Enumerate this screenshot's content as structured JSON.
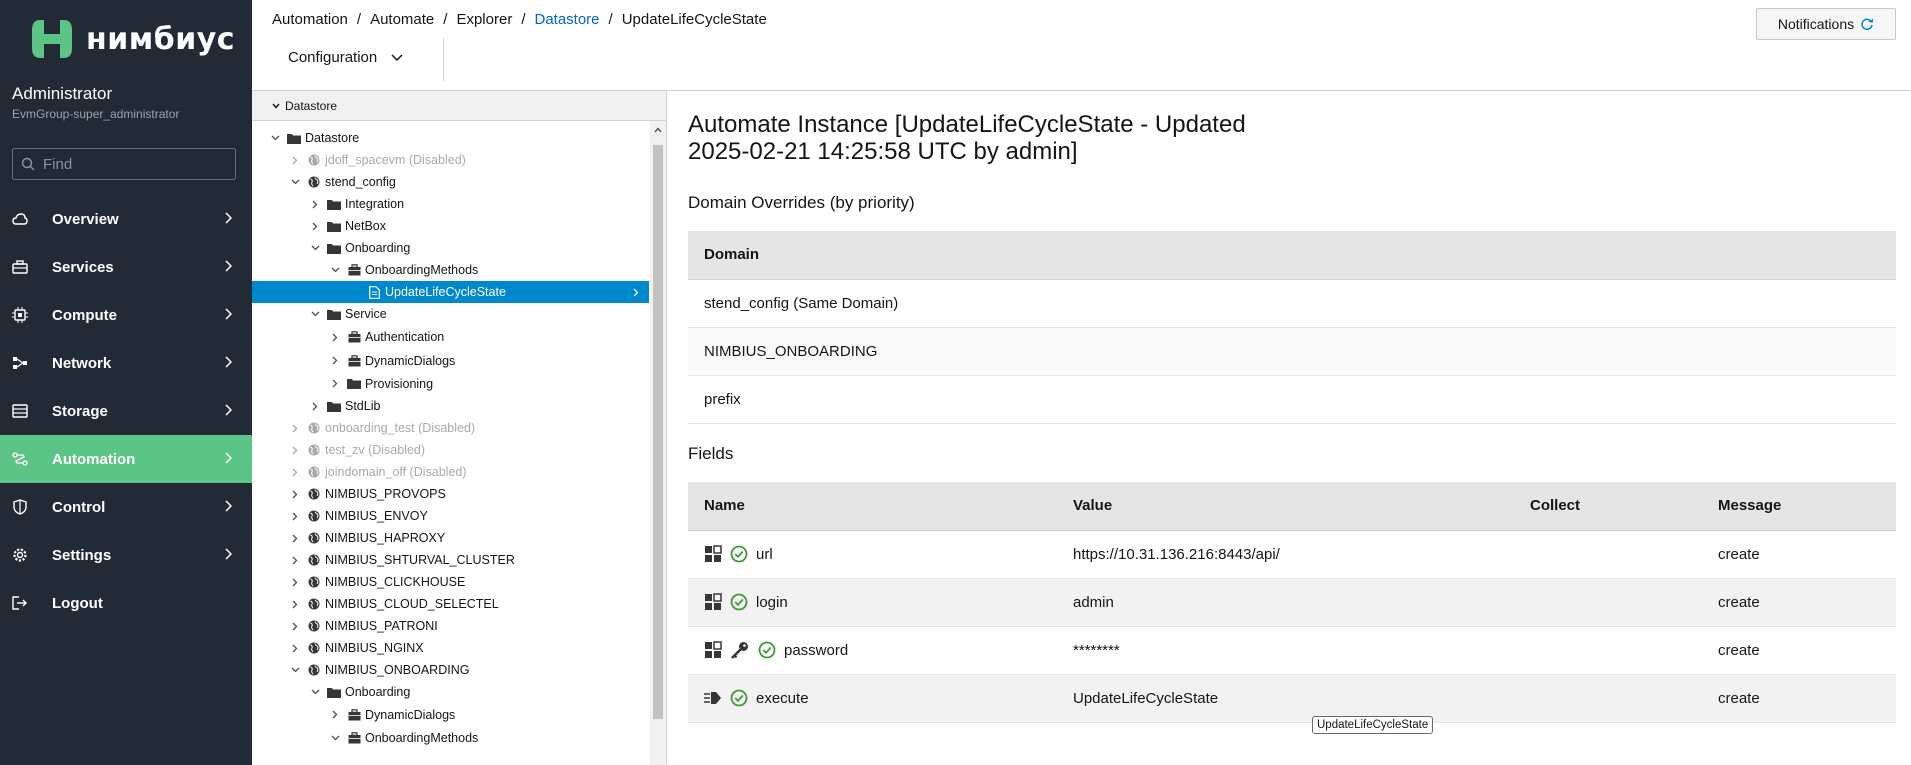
{
  "sidebar": {
    "logo_text": "нимбиус",
    "user_name": "Administrator",
    "user_group": "EvmGroup-super_administrator",
    "find_placeholder": "Find",
    "items": [
      {
        "label": "Overview",
        "icon": "cloud-icon"
      },
      {
        "label": "Services",
        "icon": "briefcase-icon"
      },
      {
        "label": "Compute",
        "icon": "cpu-icon"
      },
      {
        "label": "Network",
        "icon": "network-icon"
      },
      {
        "label": "Storage",
        "icon": "storage-icon"
      },
      {
        "label": "Automation",
        "icon": "automation-icon",
        "active": true
      },
      {
        "label": "Control",
        "icon": "shield-icon"
      },
      {
        "label": "Settings",
        "icon": "gear-icon"
      },
      {
        "label": "Logout",
        "icon": "logout-icon"
      }
    ]
  },
  "header": {
    "breadcrumb": [
      "Automation",
      "Automate",
      "Explorer",
      "Datastore",
      "UpdateLifeCycleState"
    ],
    "notifications_label": "Notifications",
    "config_label": "Configuration"
  },
  "tree": {
    "panel_title": "Datastore",
    "nodes": [
      {
        "label": "Datastore",
        "level": 0,
        "toggle": "open",
        "icon": "folder",
        "state": "normal"
      },
      {
        "label": "jdoff_spacevm (Disabled)",
        "level": 1,
        "toggle": "closed",
        "icon": "globe",
        "state": "disabled"
      },
      {
        "label": "stend_config",
        "level": 1,
        "toggle": "open",
        "icon": "globe",
        "state": "normal"
      },
      {
        "label": "Integration",
        "level": 2,
        "toggle": "closed",
        "icon": "folder",
        "state": "normal"
      },
      {
        "label": "NetBox",
        "level": 2,
        "toggle": "closed",
        "icon": "folder",
        "state": "normal"
      },
      {
        "label": "Onboarding",
        "level": 2,
        "toggle": "open",
        "icon": "folder",
        "state": "normal"
      },
      {
        "label": "OnboardingMethods",
        "level": 3,
        "toggle": "open",
        "icon": "class",
        "state": "normal"
      },
      {
        "label": "UpdateLifeCycleState",
        "level": 4,
        "toggle": "none",
        "icon": "doc",
        "state": "selected"
      },
      {
        "label": "Service",
        "level": 2,
        "toggle": "open",
        "icon": "folder",
        "state": "normal"
      },
      {
        "label": "Authentication",
        "level": 3,
        "toggle": "closed",
        "icon": "class",
        "state": "normal"
      },
      {
        "label": "DynamicDialogs",
        "level": 3,
        "toggle": "closed",
        "icon": "class",
        "state": "normal"
      },
      {
        "label": "Provisioning",
        "level": 3,
        "toggle": "closed",
        "icon": "folder",
        "state": "normal"
      },
      {
        "label": "StdLib",
        "level": 2,
        "toggle": "closed",
        "icon": "folder",
        "state": "normal"
      },
      {
        "label": "onboarding_test (Disabled)",
        "level": 1,
        "toggle": "closed",
        "icon": "globe",
        "state": "disabled"
      },
      {
        "label": "test_zv (Disabled)",
        "level": 1,
        "toggle": "closed",
        "icon": "globe",
        "state": "disabled"
      },
      {
        "label": "joindomain_off (Disabled)",
        "level": 1,
        "toggle": "closed",
        "icon": "globe",
        "state": "disabled"
      },
      {
        "label": "NIMBIUS_PROVOPS",
        "level": 1,
        "toggle": "closed",
        "icon": "globe",
        "state": "normal"
      },
      {
        "label": "NIMBIUS_ENVOY",
        "level": 1,
        "toggle": "closed",
        "icon": "globe",
        "state": "normal"
      },
      {
        "label": "NIMBIUS_HAPROXY",
        "level": 1,
        "toggle": "closed",
        "icon": "globe",
        "state": "normal"
      },
      {
        "label": "NIMBIUS_SHTURVAL_CLUSTER",
        "level": 1,
        "toggle": "closed",
        "icon": "globe",
        "state": "normal"
      },
      {
        "label": "NIMBIUS_CLICKHOUSE",
        "level": 1,
        "toggle": "closed",
        "icon": "globe",
        "state": "normal"
      },
      {
        "label": "NIMBIUS_CLOUD_SELECTEL",
        "level": 1,
        "toggle": "closed",
        "icon": "globe",
        "state": "normal"
      },
      {
        "label": "NIMBIUS_PATRONI",
        "level": 1,
        "toggle": "closed",
        "icon": "globe",
        "state": "normal"
      },
      {
        "label": "NIMBIUS_NGINX",
        "level": 1,
        "toggle": "closed",
        "icon": "globe",
        "state": "normal"
      },
      {
        "label": "NIMBIUS_ONBOARDING",
        "level": 1,
        "toggle": "open",
        "icon": "globe",
        "state": "normal"
      },
      {
        "label": "Onboarding",
        "level": 2,
        "toggle": "open",
        "icon": "folder",
        "state": "normal"
      },
      {
        "label": "DynamicDialogs",
        "level": 3,
        "toggle": "closed",
        "icon": "class",
        "state": "normal"
      },
      {
        "label": "OnboardingMethods",
        "level": 3,
        "toggle": "open",
        "icon": "class",
        "state": "normal"
      }
    ]
  },
  "main": {
    "title": "Automate Instance [UpdateLifeCycleState - Updated 2025-02-21 14:25:58 UTC by admin]",
    "domain_overrides_title": "Domain Overrides (by priority)",
    "domain_header": "Domain",
    "domains": [
      "stend_config (Same Domain)",
      "NIMBIUS_ONBOARDING",
      "prefix"
    ],
    "fields_title": "Fields",
    "fields_headers": {
      "name": "Name",
      "value": "Value",
      "collect": "Collect",
      "message": "Message"
    },
    "fields": [
      {
        "name": "url",
        "value": "https://10.31.136.216:8443/api/",
        "collect": "",
        "message": "create",
        "type_icon": "attribute-icon",
        "has_key": false
      },
      {
        "name": "login",
        "value": "admin",
        "collect": "",
        "message": "create",
        "type_icon": "attribute-icon",
        "has_key": false
      },
      {
        "name": "password",
        "value": "********",
        "collect": "",
        "message": "create",
        "type_icon": "attribute-icon",
        "has_key": true
      },
      {
        "name": "execute",
        "value": "UpdateLifeCycleState",
        "collect": "",
        "message": "create",
        "type_icon": "method-icon",
        "has_key": false
      }
    ],
    "tooltip": "UpdateLifeCycleState"
  },
  "colors": {
    "sidebar_bg": "#212a35",
    "active_nav": "#5dc487",
    "selected_tree": "#0088ce",
    "link": "#0066cc",
    "check_green": "#3f9c35"
  }
}
